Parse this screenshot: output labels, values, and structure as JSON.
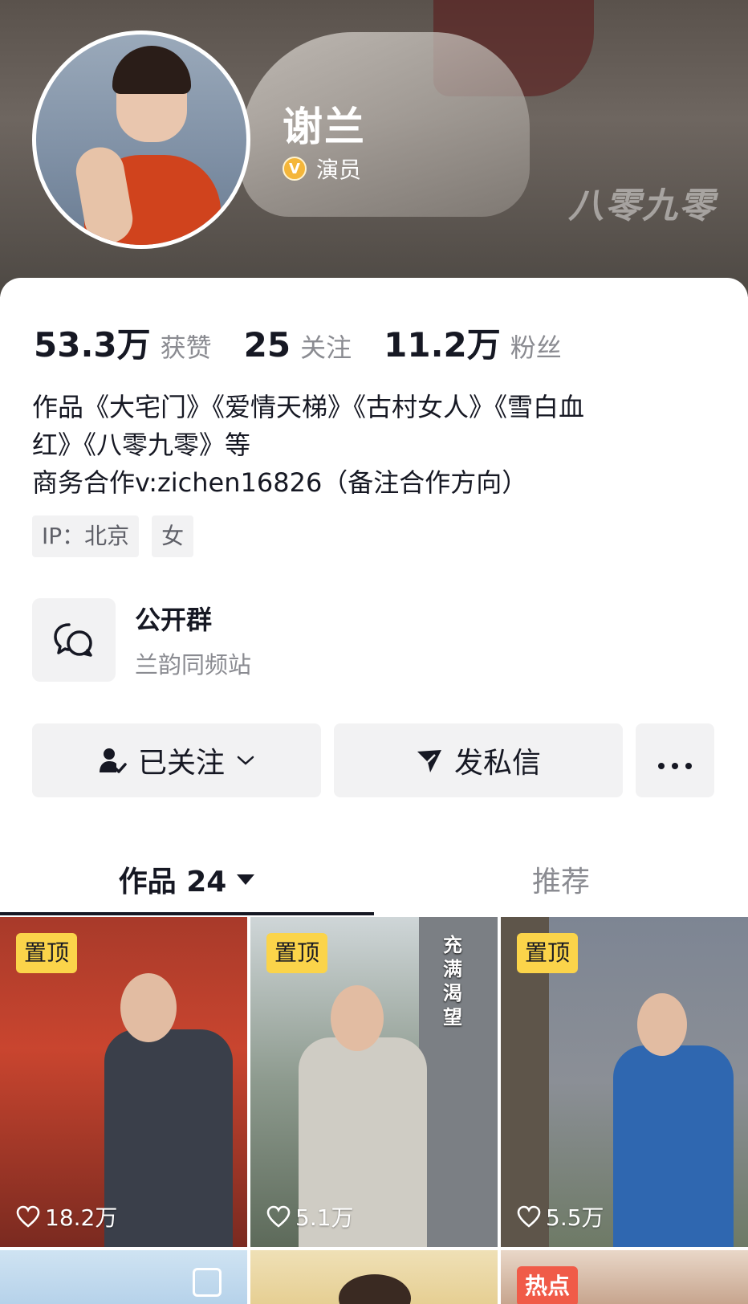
{
  "profile": {
    "name": "谢兰",
    "verify_label": "演员",
    "verify_icon": "verified-v-icon",
    "banner_watermark": "八零九零"
  },
  "stats": [
    {
      "num": "53.3万",
      "label": "获赞"
    },
    {
      "num": "25",
      "label": "关注"
    },
    {
      "num": "11.2万",
      "label": "粉丝"
    }
  ],
  "bio": {
    "line1": "作品《大宅门》《爱情天梯》《古村女人》《雪白血",
    "line2": "红》《八零九零》等",
    "line3": "商务合作v:zichen16826（备注合作方向）"
  },
  "tags": [
    "IP：北京",
    "女"
  ],
  "group": {
    "title": "公开群",
    "subtitle": "兰韵同频站",
    "icon": "chat-bubbles-icon"
  },
  "actions": {
    "follow_label": "已关注",
    "message_label": "发私信",
    "more_icon": "more-dots-icon"
  },
  "tabs": {
    "works_label": "作品 24",
    "recommend_label": "推荐"
  },
  "videos": [
    {
      "badge": "置顶",
      "likes": "18.2万"
    },
    {
      "badge": "置顶",
      "likes": "5.1万",
      "caption": "充满渴望"
    },
    {
      "badge": "置顶",
      "likes": "5.5万"
    },
    {
      "badge": ""
    },
    {
      "badge": ""
    },
    {
      "badge": "热点"
    }
  ],
  "colors": {
    "pin_badge": "#fbd44a",
    "hot_badge": "#f05b48",
    "verify": "#f4b63a",
    "text_primary": "#161823",
    "text_secondary": "#8a8b91"
  }
}
